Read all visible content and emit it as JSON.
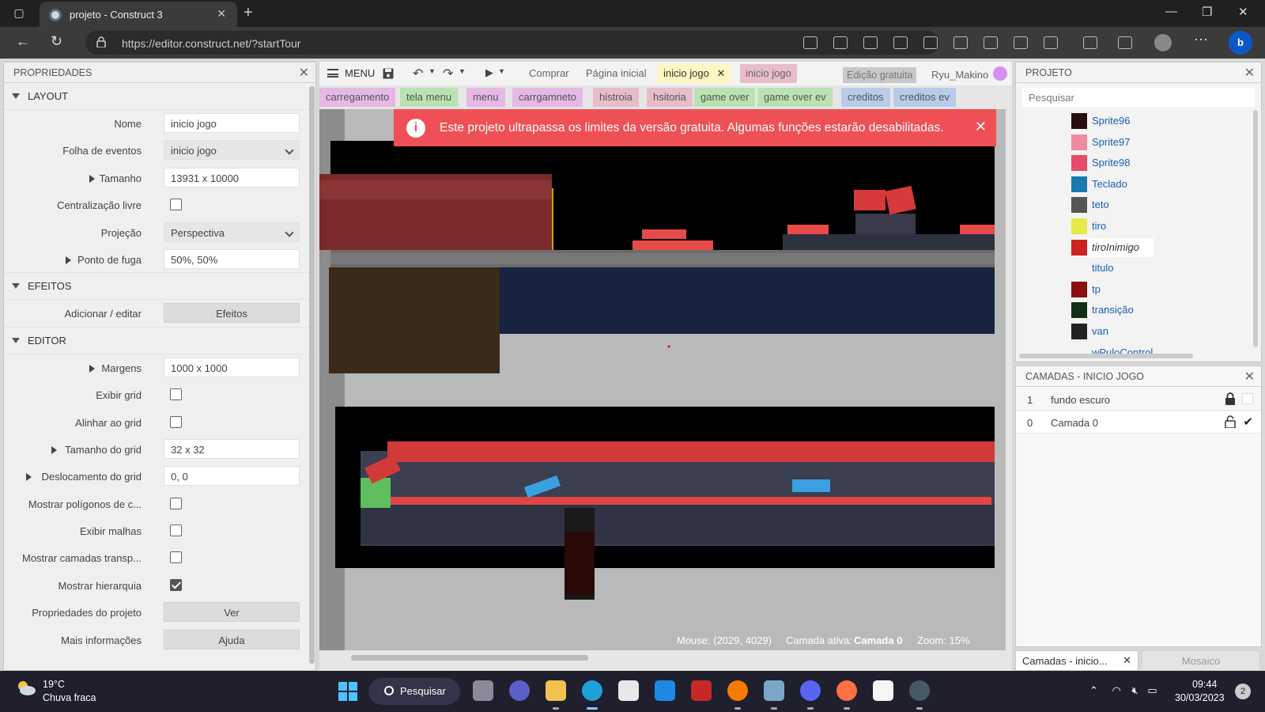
{
  "browser": {
    "tab_title": "projeto - Construct 3",
    "url": "https://editor.construct.net/?startTour"
  },
  "properties": {
    "panel_title": "PROPRIEDADES",
    "sections": {
      "layout": "LAYOUT",
      "effects": "EFEITOS",
      "editor": "EDITOR"
    },
    "layout_rows": {
      "name_label": "Nome",
      "name_value": "inicio jogo",
      "eventsheet_label": "Folha de eventos",
      "eventsheet_value": "inicio jogo",
      "size_label": "Tamanho",
      "size_value": "13931 x 10000",
      "unbounded_label": "Centralização livre",
      "projection_label": "Projeção",
      "projection_value": "Perspectiva",
      "vanishing_label": "Ponto de fuga",
      "vanishing_value": "50%, 50%"
    },
    "effect_rows": {
      "add_label": "Adicionar / editar",
      "add_button": "Efeitos"
    },
    "editor_rows": {
      "margins_label": "Margens",
      "margins_value": "1000 x 1000",
      "showgrid_label": "Exibir grid",
      "snap_label": "Alinhar ao grid",
      "gridsize_label": "Tamanho do grid",
      "gridsize_value": "32 x 32",
      "gridoffset_label": "Deslocamento do grid",
      "gridoffset_value": "0, 0",
      "polygons_label": "Mostrar polígonos de c...",
      "meshes_label": "Exibir malhas",
      "translayers_label": "Mostrar camadas transp...",
      "hierarchy_label": "Mostrar hierarquia",
      "projprops_label": "Propriedades do projeto",
      "projprops_button": "Ver",
      "moreinfo_label": "Mais informações",
      "moreinfo_button": "Ajuda"
    },
    "checkbox_states": {
      "unbounded": false,
      "showgrid": false,
      "snap": false,
      "polygons": false,
      "meshes": false,
      "translayers": false,
      "hierarchy": true
    }
  },
  "toolbar": {
    "menu_label": "MENU",
    "buy": "Comprar",
    "home": "Página inicial",
    "active_tab": "inicio jogo",
    "event_tab": "inicio jogo",
    "edition": "Edição gratuita",
    "user": "Ryu_Makino"
  },
  "layout_tabs": [
    {
      "label": "carregamento",
      "color": "#e6b8e6"
    },
    {
      "label": "tela menu",
      "color": "#b9e3b0"
    },
    {
      "label": "menu",
      "color": "#e6b8e6"
    },
    {
      "label": "carrgamneto",
      "color": "#e6b8e6"
    },
    {
      "label": "histroia",
      "color": "#e8bcc9"
    },
    {
      "label": "hsitoria",
      "color": "#e8bcc9"
    },
    {
      "label": "game over",
      "color": "#b9e3b0"
    },
    {
      "label": "game over ev",
      "color": "#b9e3b0"
    },
    {
      "label": "creditos",
      "color": "#b8cbe8"
    },
    {
      "label": "creditos ev",
      "color": "#b8cbe8"
    }
  ],
  "warning": {
    "text": "Este projeto ultrapassa os limites da versão gratuita. Algumas funções estarão desabilitadas."
  },
  "status": {
    "mouse": "Mouse: (2029, 4029)",
    "active_layer_label": "Camada ativa:",
    "active_layer_value": "Camada 0",
    "zoom": "Zoom: 15%"
  },
  "project": {
    "title": "PROJETO",
    "search_placeholder": "Pesquisar",
    "items": [
      {
        "label": "Sprite96",
        "color": "#2a0d0d"
      },
      {
        "label": "Sprite97",
        "color": "#f08aa0"
      },
      {
        "label": "Sprite98",
        "color": "#e84a6a"
      },
      {
        "label": "Teclado",
        "color": "#1a7ab0"
      },
      {
        "label": "teto",
        "color": "#555555"
      },
      {
        "label": "tiro",
        "color": "#e8e84a"
      },
      {
        "label": "tiroInimigo",
        "color": "#cc2222"
      },
      {
        "label": "titulo",
        "color": "#f3f3f3"
      },
      {
        "label": "tp",
        "color": "#8a1010"
      },
      {
        "label": "transição",
        "color": "#123018"
      },
      {
        "label": "van",
        "color": "#222222"
      },
      {
        "label": "wPuloControl",
        "color": "#f3f3f3"
      }
    ]
  },
  "layers": {
    "title": "CAMADAS - INICIO JOGO",
    "rows": [
      {
        "index": "1",
        "name": "fundo escuro"
      },
      {
        "index": "0",
        "name": "Camada 0"
      }
    ]
  },
  "bottom_tabs": {
    "layers": "Camadas - inicio...",
    "tiles": "Mosaico"
  },
  "taskbar": {
    "temp": "19°C",
    "weather": "Chuva fraca",
    "search": "Pesquisar",
    "time": "09:44",
    "date": "30/03/2023",
    "notifications": "2"
  }
}
